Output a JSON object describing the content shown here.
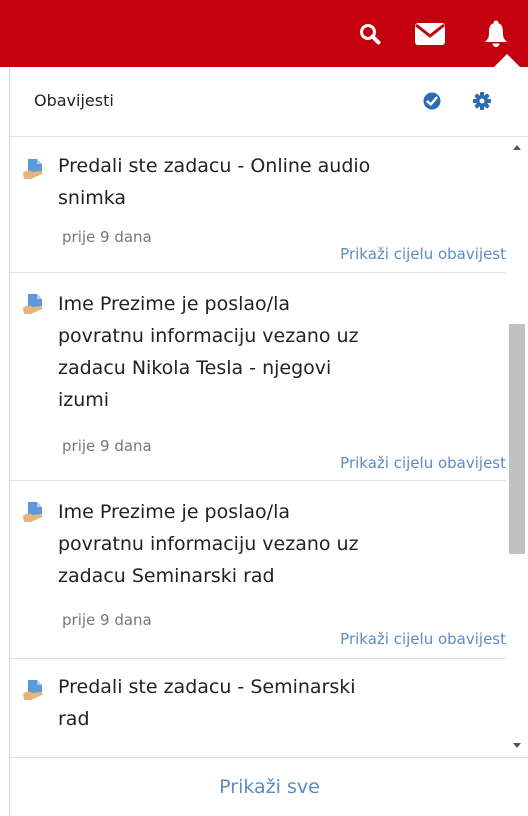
{
  "topbar": {
    "icons": [
      "search-icon",
      "envelope-icon",
      "bell-icon"
    ],
    "color": "#c4000f"
  },
  "panel": {
    "title": "Obavijesti",
    "actions": [
      "mark-all-read-icon",
      "settings-gear-icon"
    ]
  },
  "notifications": [
    {
      "lines": [
        "Predali ste zadacu - Online audio",
        "snimka"
      ],
      "time": "prije 9 dana",
      "link": "Prikaži cijelu obavijest"
    },
    {
      "lines": [
        "Ime Prezime je poslao/la",
        "povratnu informaciju vezano uz",
        "zadacu Nikola Tesla - njegovi",
        "izumi"
      ],
      "time": "prije 9 dana",
      "link": "Prikaži cijelu obavijest"
    },
    {
      "lines": [
        "Ime Prezime je poslao/la",
        "povratnu informaciju vezano uz",
        "zadacu Seminarski rad"
      ],
      "time": "prije 9 dana",
      "link": "Prikaži cijelu obavijest"
    },
    {
      "lines": [
        "Predali ste zadacu - Seminarski",
        "rad"
      ]
    }
  ],
  "footer": {
    "show_all": "Prikaži sve"
  },
  "colors": {
    "accent_red": "#c4000f",
    "link_blue": "#5b8cc4",
    "check_blue": "#2a6bb3"
  }
}
